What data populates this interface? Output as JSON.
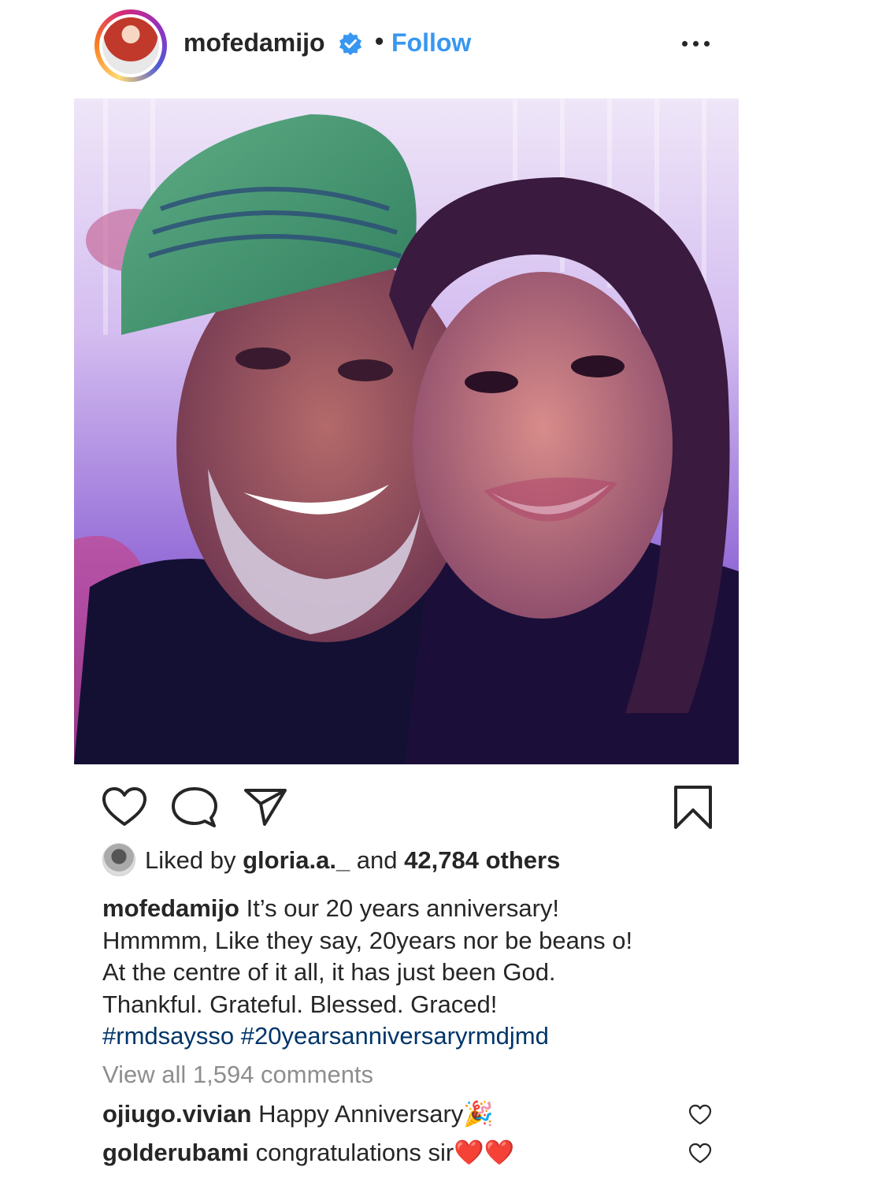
{
  "header": {
    "username": "mofedamijo",
    "separator": "•",
    "follow_label": "Follow"
  },
  "post": {
    "photo_description": "selfie-photo"
  },
  "likes": {
    "prefix": "Liked by ",
    "user": "gloria.a._",
    "middle": " and ",
    "count": "42,784 others"
  },
  "caption": {
    "username": "mofedamijo",
    "line1": " It’s our 20 years anniversary!",
    "line2": "Hmmmm, Like they say, 20years nor be beans o!",
    "line3": "At the centre of it all, it has just been God.",
    "line4": "Thankful. Grateful. Blessed. Graced!",
    "hashtag1": "#rmdsaysso",
    "hashtag2": "#20yearsanniversaryrmdjmd"
  },
  "comments": {
    "view_all": "View all 1,594 comments",
    "items": [
      {
        "user": "ojiugo.vivian",
        "text": " Happy Anniversary🎉"
      },
      {
        "user": "golderubami",
        "text": " congratulations sir❤️❤️"
      }
    ]
  },
  "colors": {
    "link": "#3897f0",
    "hashtag": "#003569",
    "muted": "#8e8e8e",
    "text": "#262626"
  }
}
